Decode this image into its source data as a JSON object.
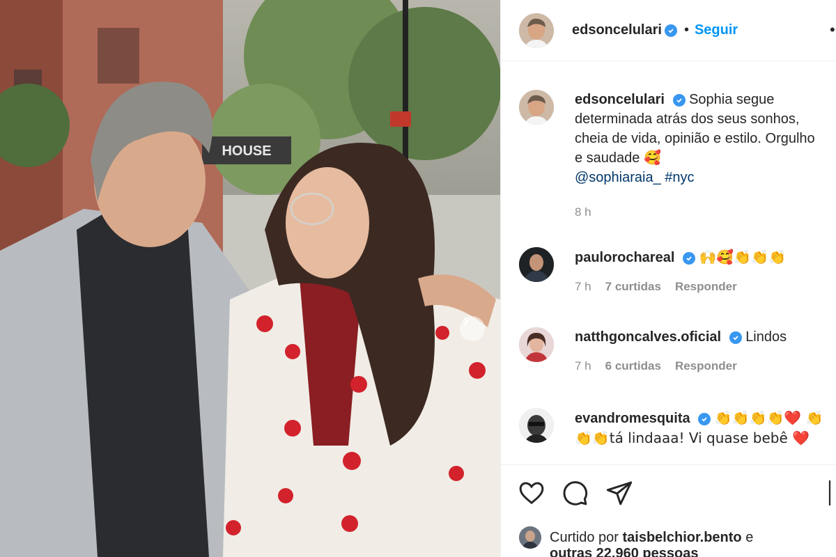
{
  "post": {
    "author": "edsoncelulari",
    "follow_label": "Seguir",
    "separator": "•",
    "more_glyph": "•••"
  },
  "caption": {
    "username": "edsoncelulari",
    "text": "Sophia segue determinada atrás dos seus sonhos, cheia de vida, opinião e estilo. Orgulho e saudade 🥰",
    "mention": "@sophiaraia_",
    "hashtag": "#nyc",
    "time": "8 h"
  },
  "comments": [
    {
      "username": "paulorochareal",
      "verified": true,
      "text": "🙌🥰👏👏👏",
      "time": "7 h",
      "likes": "7 curtidas",
      "reply": "Responder"
    },
    {
      "username": "natthgoncalves.oficial",
      "verified": true,
      "text": "Lindos",
      "time": "7 h",
      "likes": "6 curtidas",
      "reply": "Responder"
    },
    {
      "username": "evandromesquita",
      "verified": true,
      "text": "👏👏👏👏❤️ 👏👏👏tá lindaaa! Vi quase bebê ❤️"
    }
  ],
  "photo": {
    "sign_text": "HOUSE"
  },
  "likes": {
    "prefix": "Curtido por",
    "user": "taisbelchior.bento",
    "and": "e",
    "others": "outras 22.960 pessoas"
  },
  "colors": {
    "accent": "#0095f6",
    "verified": "#3897f0",
    "muted": "#8e8e8e",
    "link": "#00376b"
  },
  "icons": [
    "verified-badge-icon",
    "more-icon",
    "heart-icon",
    "comment-icon",
    "share-icon",
    "bookmark-icon",
    "chevron-right-icon"
  ]
}
